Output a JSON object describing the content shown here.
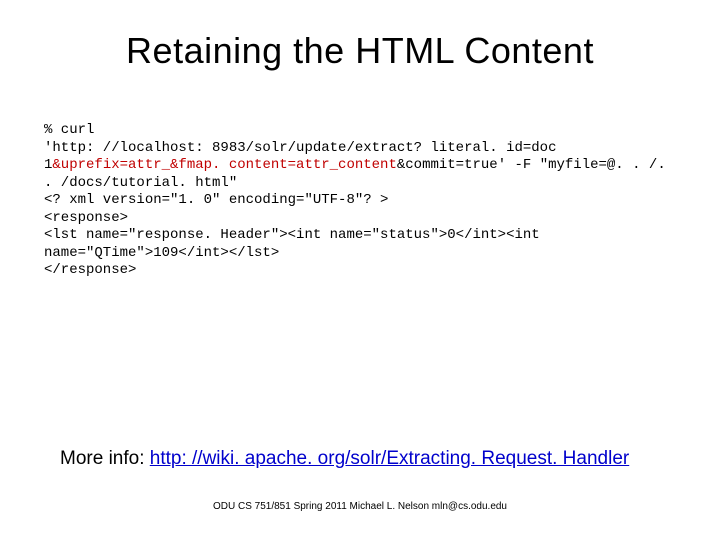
{
  "title": "Retaining the HTML Content",
  "code": {
    "l1": "% curl",
    "l2a": "'http: //localhost: 8983/solr/update/extract? literal. id=doc 1",
    "l2b": "&uprefix=attr_&fmap. content=attr_content",
    "l2c": "&commit=true' -F \"myfile=@. . /. . /docs/tutorial. html\"",
    "l3": "<? xml version=\"1. 0\" encoding=\"UTF-8\"? >",
    "l4": "<response>",
    "l5": "<lst name=\"response. Header\"><int name=\"status\">0</int><int name=\"QTime\">109</int></lst>",
    "l6": "</response>"
  },
  "more_info_label": "More info: ",
  "more_info_link": "http: //wiki. apache. org/solr/Extracting. Request. Handler",
  "footer": "ODU CS 751/851 Spring 2011 Michael L. Nelson mln@cs.odu.edu"
}
